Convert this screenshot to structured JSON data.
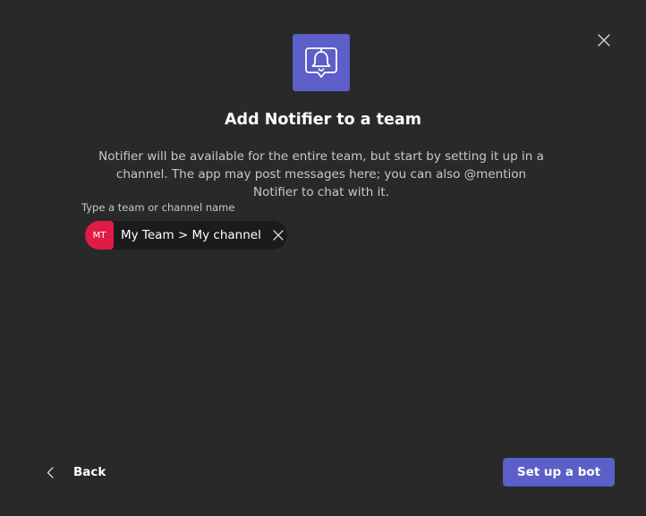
{
  "dialog": {
    "title": "Add Notifier to a team",
    "description": "Notifier will be available for the entire team, but start by setting it up in a channel. The app may post messages here; you can also @mention Notifier to chat with it.",
    "app_icon": "bell-icon",
    "close_icon": "close-icon"
  },
  "team_picker": {
    "label": "Type a team or channel name",
    "selected": {
      "avatar_initials": "MT",
      "avatar_color": "#e01b48",
      "text": "My Team > My channel",
      "remove_icon": "close-icon"
    }
  },
  "footer": {
    "back_label": "Back",
    "back_icon": "chevron-left-icon",
    "primary_label": "Set up a bot"
  },
  "colors": {
    "background": "#292929",
    "accent": "#5b5fc7",
    "muted_text": "#c8c8c8"
  }
}
